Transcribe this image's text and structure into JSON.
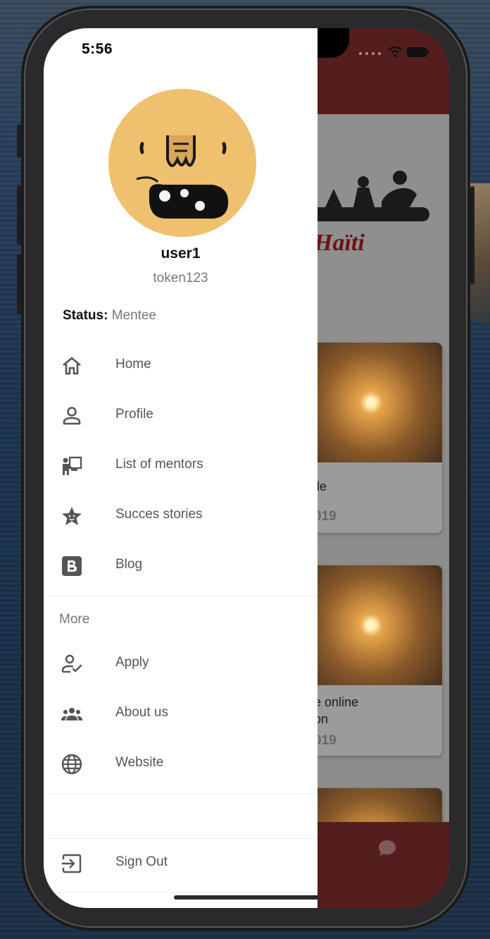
{
  "status_bar": {
    "time": "5:56"
  },
  "user": {
    "name": "user1",
    "token": "token123"
  },
  "status": {
    "label": "Status:",
    "value": "Mentee"
  },
  "menu": [
    {
      "label": "Home",
      "icon": "home-icon"
    },
    {
      "label": "Profile",
      "icon": "person-icon"
    },
    {
      "label": "List of mentors",
      "icon": "presenter-icon"
    },
    {
      "label": "Succes stories",
      "icon": "star-badge-icon"
    },
    {
      "label": "Blog",
      "icon": "blogger-icon"
    }
  ],
  "more": {
    "title": "More",
    "items": [
      {
        "label": "Apply",
        "icon": "person-check-icon"
      },
      {
        "label": "About us",
        "icon": "group-icon"
      },
      {
        "label": "Website",
        "icon": "globe-icon"
      }
    ]
  },
  "sign_out": {
    "label": "Sign Out",
    "icon": "sign-out-icon"
  },
  "background_app": {
    "logo_text": "Haïti",
    "cards": [
      {
        "title": "ile",
        "date": "019"
      },
      {
        "title_line1": "e online",
        "title_line2": "on",
        "date": "019"
      }
    ]
  },
  "colors": {
    "app_bar": "#551e1e",
    "drawer_bg": "#ffffff",
    "icon": "#5a5a5a",
    "avatar_bg": "#efc06e"
  }
}
